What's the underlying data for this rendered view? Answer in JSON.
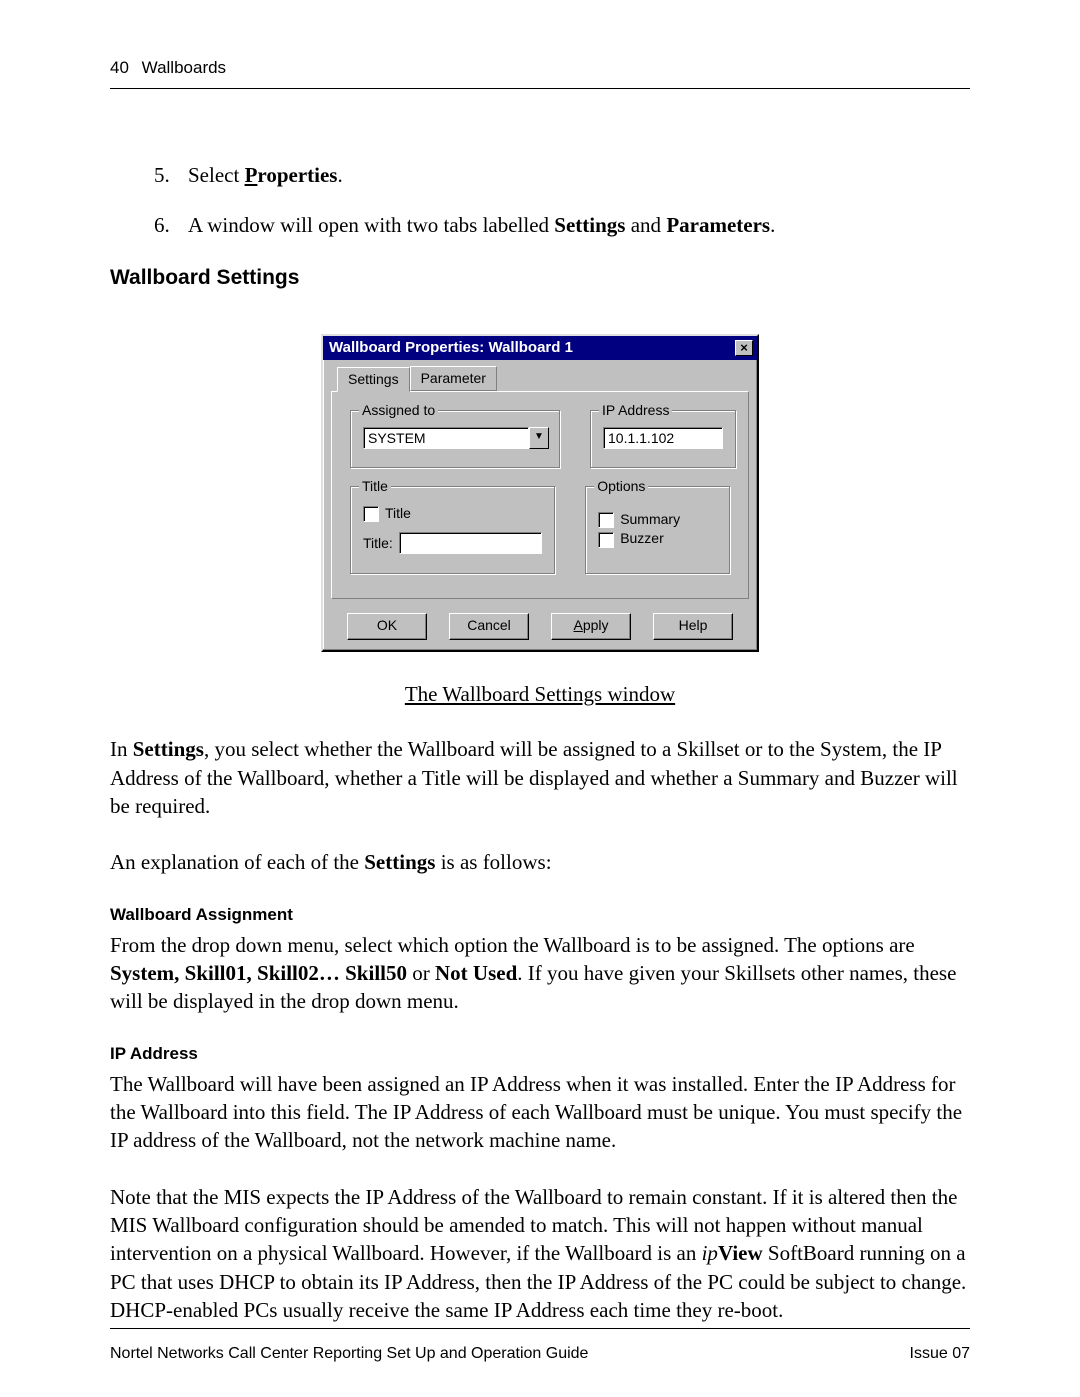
{
  "header": {
    "page_number": "40",
    "section": "Wallboards"
  },
  "steps": {
    "5": {
      "num": "5.",
      "prefix": "Select ",
      "link_letter": "P",
      "link_rest": "roperties",
      "suffix": "."
    },
    "6": {
      "num": "6.",
      "text_a": "A window will open with two tabs labelled ",
      "b1": "Settings",
      "mid": " and ",
      "b2": "Parameters",
      "suffix": "."
    }
  },
  "heading_wb_settings": "Wallboard Settings",
  "dialog": {
    "title": "Wallboard Properties: Wallboard  1",
    "close_glyph": "×",
    "tabs": {
      "settings": "Settings",
      "parameter": "Parameter"
    },
    "group": {
      "assigned_to": "Assigned to",
      "ip_address": "IP Address",
      "title": "Title",
      "options": "Options"
    },
    "assigned_value": "SYSTEM",
    "combo_arrow": "▼",
    "ip_value": "10.1.1.102",
    "title_chk_label": "Title",
    "title_field_label": "Title:",
    "options_summary": "Summary",
    "options_buzzer": "Buzzer",
    "buttons": {
      "ok": "OK",
      "cancel": "Cancel",
      "apply_u": "A",
      "apply_rest": "pply",
      "help": "Help"
    }
  },
  "caption": "The Wallboard Settings window",
  "para1": {
    "a": "In ",
    "b": "Settings",
    "c": ", you select whether the Wallboard will be assigned to a Skillset or to the System, the IP Address of the Wallboard, whether a Title will be displayed and whether a Summary and Buzzer will be required."
  },
  "para2": {
    "a": "An explanation of each of the ",
    "b": "Settings",
    "c": " is as follows:"
  },
  "sub_wa": "Wallboard Assignment",
  "para_wa": {
    "a": "From the drop down menu, select which option the Wallboard is to be assigned. The options are ",
    "b": "System, Skill01, Skill02… Skill50",
    "c": " or ",
    "d": "Not Used",
    "e": ".  If you have given your Skillsets other names, these will be displayed in the drop down menu."
  },
  "sub_ip": "IP Address",
  "para_ip1": "The Wallboard will have been assigned an IP Address when it was installed.  Enter the IP Address for the Wallboard into this field.  The IP Address of each Wallboard must be unique.  You must specify the IP address of the Wallboard, not the network machine name.",
  "para_ip2": {
    "a": "Note that the MIS expects the IP Address of the Wallboard to remain constant.  If it is altered then the MIS Wallboard configuration should be amended to match.  This will not happen without manual intervention on a physical Wallboard.  However, if the Wallboard is an ",
    "i": "ip",
    "b": "View",
    "c": " SoftBoard running on a PC that uses DHCP to obtain its IP Address, then the IP Address of the PC could be subject to change.  DHCP-enabled PCs usually receive the same IP Address each time they re-boot."
  },
  "footer": {
    "left": "Nortel Networks Call Center Reporting Set Up and Operation Guide",
    "right": "Issue 07"
  }
}
